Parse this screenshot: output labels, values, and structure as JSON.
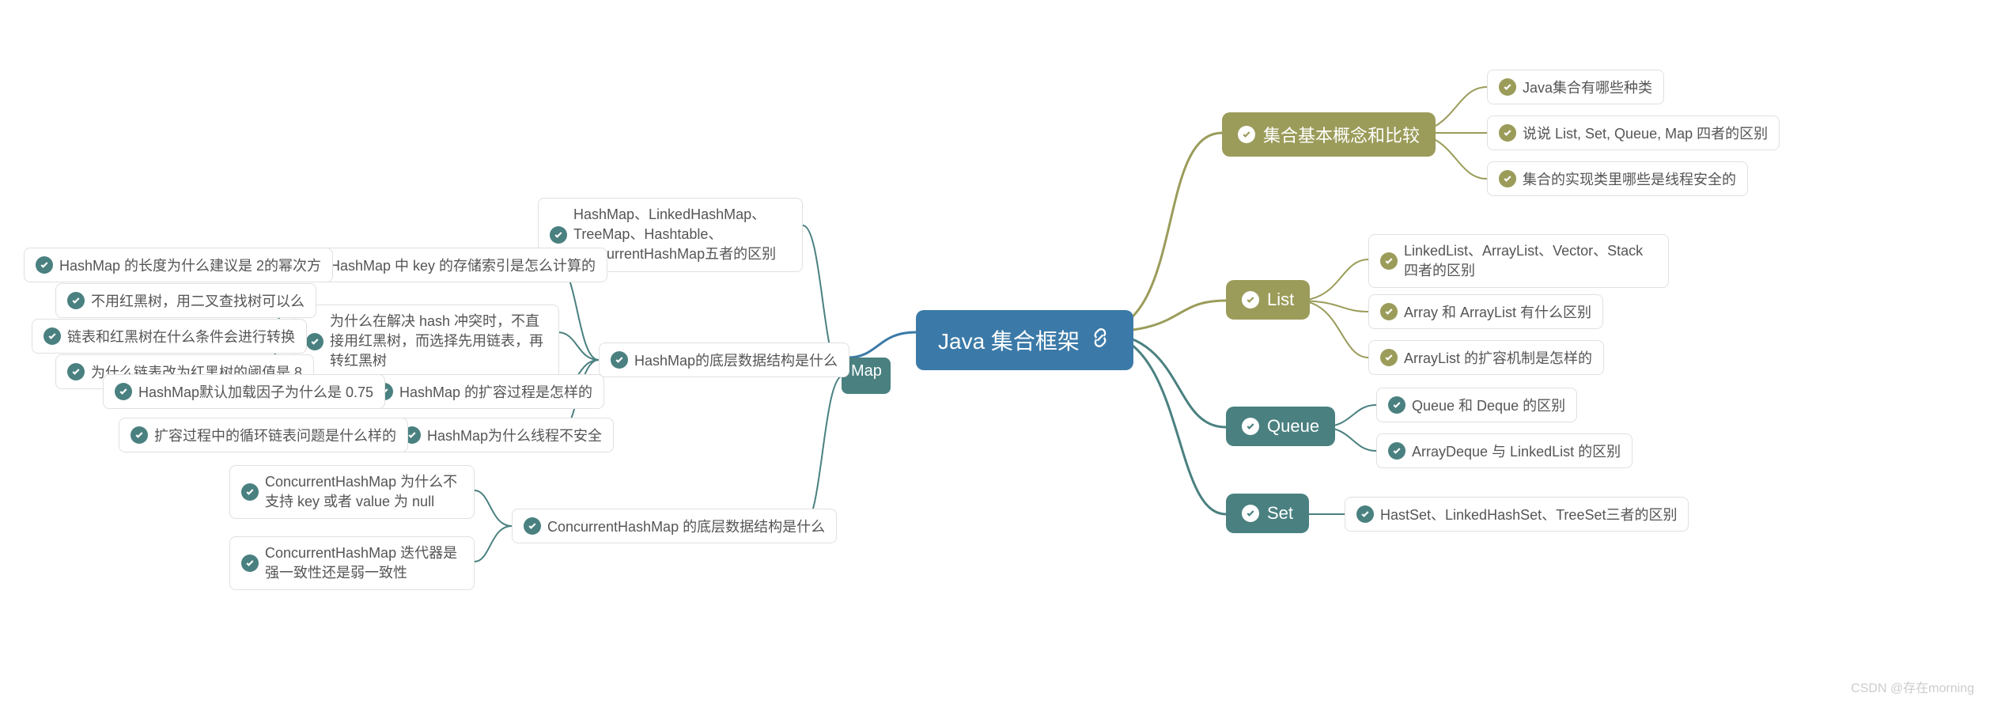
{
  "root": "Java 集合框架",
  "watermark": "CSDN @存在morning",
  "right": {
    "basic": {
      "label": "集合基本概念和比较",
      "items": [
        "Java集合有哪些种类",
        "说说 List, Set, Queue, Map 四者的区别",
        "集合的实现类里哪些是线程安全的"
      ]
    },
    "list": {
      "label": "List",
      "items": [
        "LinkedList、ArrayList、Vector、Stack四者的区别",
        "Array 和 ArrayList 有什么区别",
        "ArrayList 的扩容机制是怎样的"
      ]
    },
    "queue": {
      "label": "Queue",
      "items": [
        "Queue 和 Deque 的区别",
        "ArrayDeque 与 LinkedList 的区别"
      ]
    },
    "set": {
      "label": "Set",
      "items": [
        "HastSet、LinkedHashSet、TreeSet三者的区别"
      ]
    }
  },
  "left": {
    "map": {
      "label": "Map",
      "n1": "HashMap、LinkedHashMap、TreeMap、Hashtable、ConcurrentHashMap五者的区别",
      "n2": {
        "label": "HashMap的底层数据结构是什么",
        "sub": [
          {
            "label": "HashMap 中 key 的存储索引是怎么计算的",
            "leafs": [
              "HashMap 的长度为什么建议是 2的幂次方"
            ]
          },
          {
            "label": "为什么在解决 hash 冲突时，不直接用红黑树，而选择先用链表，再转红黑树",
            "leafs": [
              "不用红黑树，用二叉查找树可以么",
              "链表和红黑树在什么条件会进行转换",
              "为什么链表改为红黑树的阈值是 8"
            ]
          },
          {
            "label": "HashMap 的扩容过程是怎样的",
            "leafs": [
              "HashMap默认加载因子为什么是 0.75"
            ]
          },
          {
            "label": "HashMap为什么线程不安全",
            "leafs": [
              "扩容过程中的循环链表问题是什么样的"
            ]
          }
        ]
      },
      "n3": {
        "label": "ConcurrentHashMap 的底层数据结构是什么",
        "leafs": [
          "ConcurrentHashMap 为什么不支持 key 或者 value 为 null",
          "ConcurrentHashMap 迭代器是强一致性还是弱一致性"
        ]
      }
    }
  }
}
